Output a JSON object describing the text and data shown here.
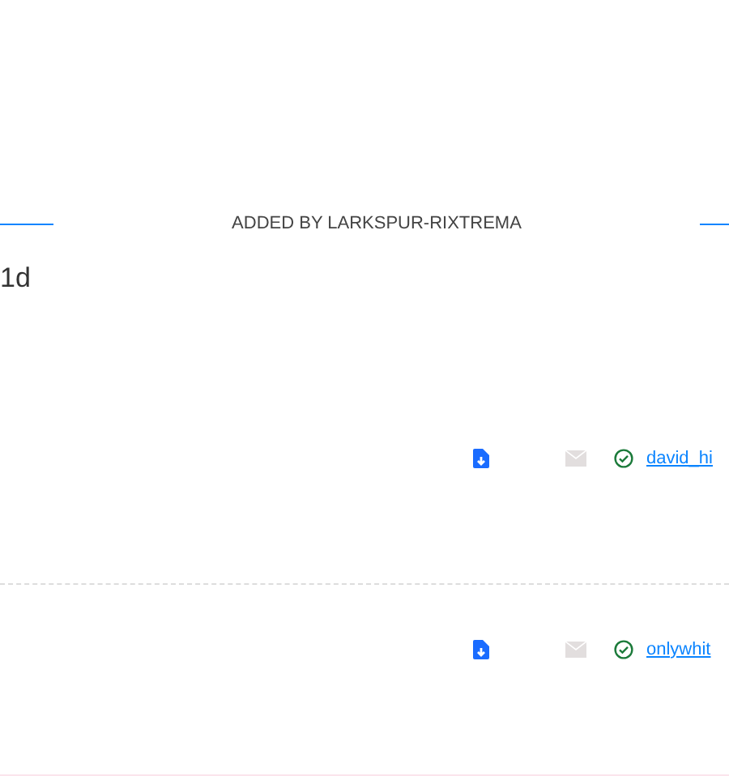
{
  "section": {
    "title": "ADDED BY LARKSPUR-RIXTREMA"
  },
  "age": "1d",
  "rows": [
    {
      "verified": true,
      "user": "david_hi"
    },
    {
      "verified": true,
      "user": "onlywhit"
    }
  ]
}
